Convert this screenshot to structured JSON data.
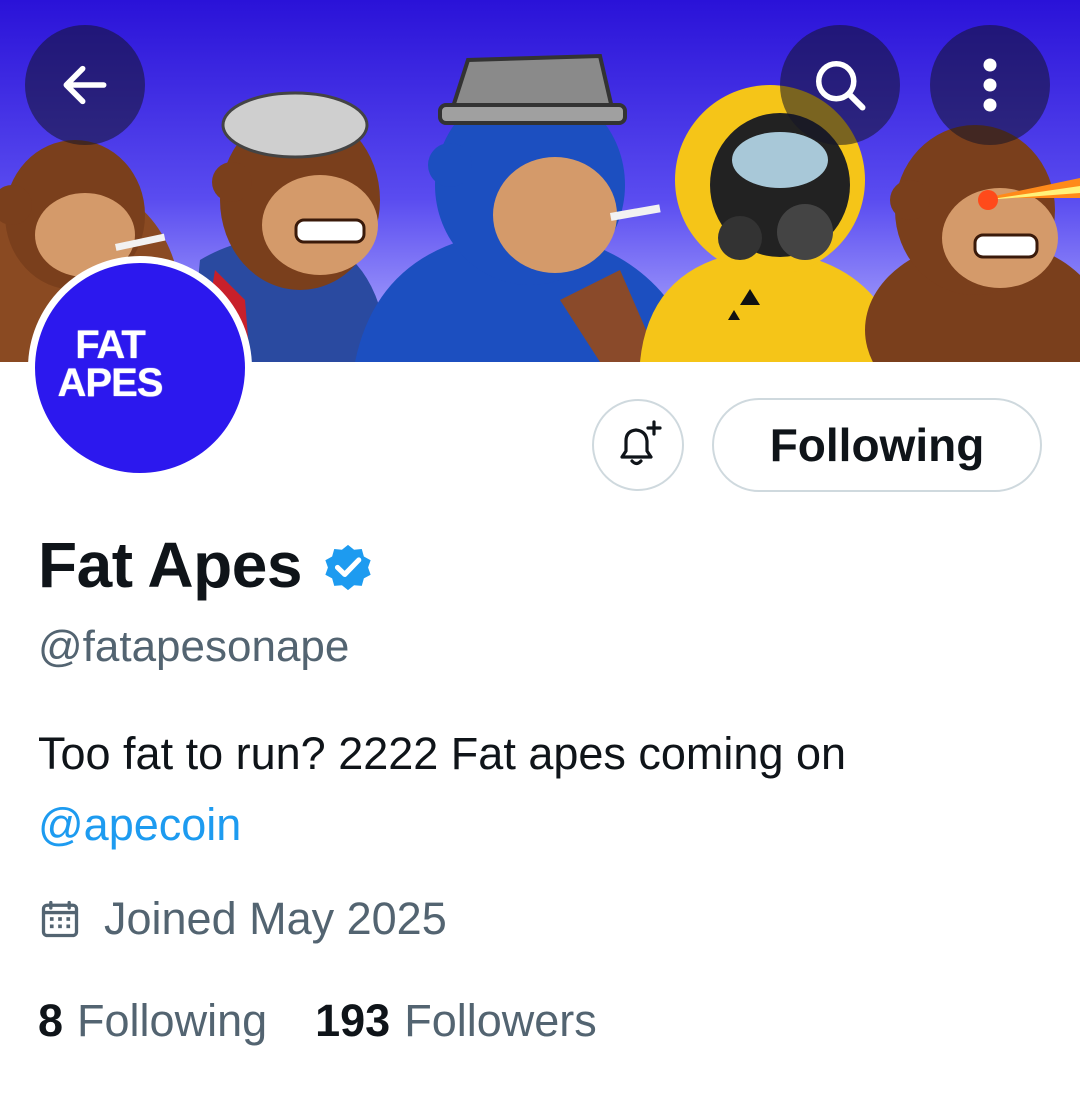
{
  "header": {
    "back_icon": "arrow-left-icon",
    "search_icon": "search-icon",
    "more_icon": "more-vertical-icon"
  },
  "avatar": {
    "line1": "FAT",
    "line2": "APES",
    "bg_color": "#2c18ee"
  },
  "actions": {
    "notify_icon": "bell-plus-icon",
    "following_label": "Following"
  },
  "profile": {
    "name": "Fat Apes",
    "verified_icon": "verified-badge-icon",
    "handle": "@fatapesonape",
    "bio_text": "Too fat to run?  2222 Fat apes coming on",
    "bio_mention": "@apecoin",
    "joined_icon": "calendar-icon",
    "joined": "Joined May 2025"
  },
  "stats": {
    "following_count": "8",
    "following_label": "Following",
    "followers_count": "193",
    "followers_label": "Followers"
  },
  "colors": {
    "accent": "#1d9bf0",
    "text": "#0f1419",
    "muted": "#536471",
    "border": "#cfd9de"
  }
}
